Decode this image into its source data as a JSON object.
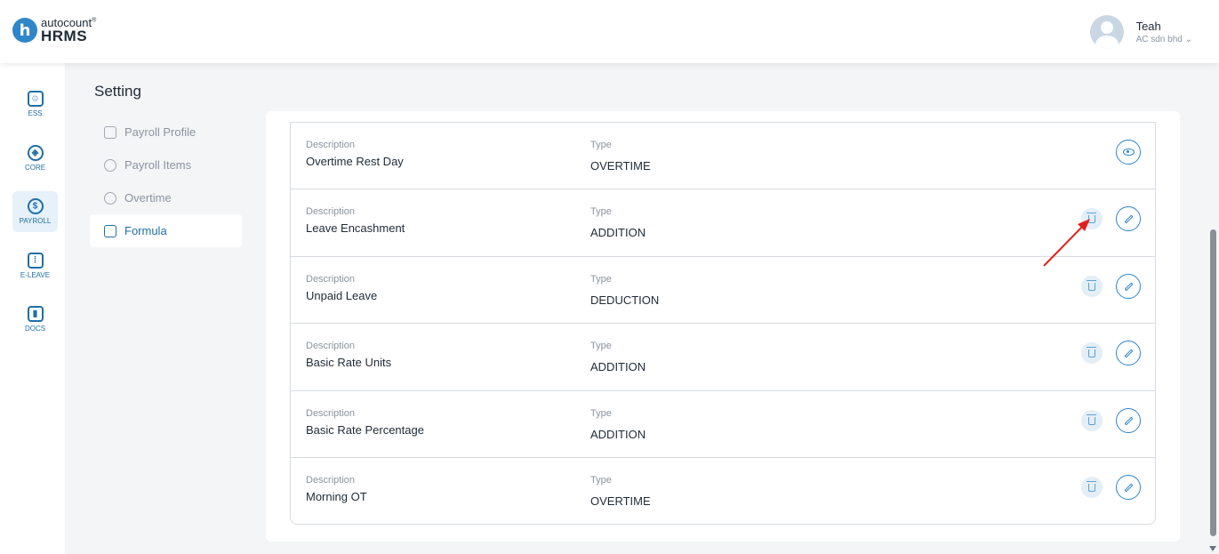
{
  "brand": {
    "top": "autocount",
    "mark": "®",
    "bottom": "HRMS",
    "logo_letter": "h"
  },
  "user": {
    "name": "Teah",
    "company": "AC sdn bhd"
  },
  "nav": [
    {
      "label": "ESS",
      "icon": "profile-icon"
    },
    {
      "label": "CORE",
      "icon": "cube-icon"
    },
    {
      "label": "PAYROLL",
      "icon": "dollar-icon",
      "active": true
    },
    {
      "label": "E-LEAVE",
      "icon": "calendar-icon"
    },
    {
      "label": "DOCS",
      "icon": "document-chart-icon"
    }
  ],
  "settings": {
    "title": "Setting",
    "menu": [
      {
        "label": "Payroll Profile",
        "icon": "calendar-icon"
      },
      {
        "label": "Payroll Items",
        "icon": "coins-icon"
      },
      {
        "label": "Overtime",
        "icon": "clock-icon"
      },
      {
        "label": "Formula",
        "icon": "formula-icon",
        "active": true
      }
    ]
  },
  "list": {
    "desc_label": "Description",
    "type_label": "Type",
    "rows": [
      {
        "description": "Overtime Rest Day",
        "type": "OVERTIME",
        "actions": [
          "view"
        ]
      },
      {
        "description": "Leave Encashment",
        "type": "ADDITION",
        "actions": [
          "delete",
          "edit"
        ]
      },
      {
        "description": "Unpaid Leave",
        "type": "DEDUCTION",
        "actions": [
          "delete",
          "edit"
        ]
      },
      {
        "description": "Basic Rate Units",
        "type": "ADDITION",
        "actions": [
          "delete",
          "edit"
        ]
      },
      {
        "description": "Basic Rate Percentage",
        "type": "ADDITION",
        "actions": [
          "delete",
          "edit"
        ]
      },
      {
        "description": "Morning OT",
        "type": "OVERTIME",
        "actions": [
          "delete",
          "edit"
        ]
      }
    ]
  },
  "colors": {
    "accent": "#2f86c8",
    "nav": "#1e6fa8",
    "annotation": "#e02020"
  }
}
